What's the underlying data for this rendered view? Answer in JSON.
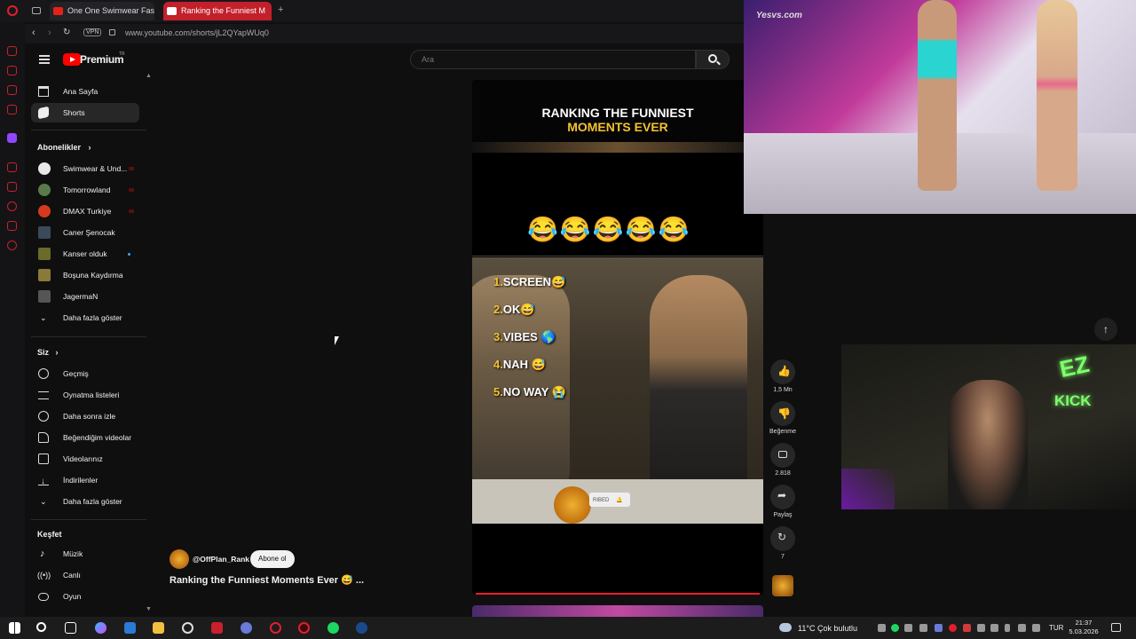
{
  "browser": {
    "tabs": [
      {
        "label": "One One Swimwear Fashi",
        "active": false
      },
      {
        "label": "Ranking the Funniest M",
        "active": true
      }
    ],
    "new_tab": "+",
    "vpn_badge": "VPN",
    "url": "www.youtube.com/shorts/jL2QYapWUq0"
  },
  "header": {
    "logo_text": "Premium",
    "logo_badge": "TR",
    "search_placeholder": "Ara"
  },
  "sidebar": {
    "main": [
      {
        "label": "Ana Sayfa",
        "icon": "home-icon"
      },
      {
        "label": "Shorts",
        "icon": "shorts-icon",
        "active": true
      }
    ],
    "subscriptions_title": "Abonelikler",
    "subscriptions": [
      {
        "label": "Swimwear & Und..."
      },
      {
        "label": "Tomorrowland"
      },
      {
        "label": "DMAX Turkiye"
      },
      {
        "label": "Caner Şenocak"
      },
      {
        "label": "Kanser olduk"
      },
      {
        "label": "Boşuna Kaydırma"
      },
      {
        "label": "JagermaN"
      }
    ],
    "show_more_1": "Daha fazla göster",
    "you_title": "Siz",
    "you_items": [
      {
        "label": "Geçmiş",
        "icon": "history-icon"
      },
      {
        "label": "Oynatma listeleri",
        "icon": "playlist-icon"
      },
      {
        "label": "Daha sonra izle",
        "icon": "watch-later-icon"
      },
      {
        "label": "Beğendiğim videolar",
        "icon": "like-icon"
      },
      {
        "label": "Videolarınız",
        "icon": "your-videos-icon"
      },
      {
        "label": "İndirilenler",
        "icon": "download-icon"
      }
    ],
    "show_more_2": "Daha fazla göster",
    "explore_title": "Keşfet",
    "explore_items": [
      {
        "label": "Müzik",
        "icon": "music-icon"
      },
      {
        "label": "Canlı",
        "icon": "live-icon"
      },
      {
        "label": "Oyun",
        "icon": "gaming-icon"
      }
    ]
  },
  "short": {
    "banner_line1": "RANKING THE FUNNIEST",
    "banner_line2": "MOMENTS EVER",
    "emoji_row": "😂😂😂😂😂",
    "list": [
      {
        "n": "1.",
        "text": "SCREEN😅"
      },
      {
        "n": "2.",
        "text": "OK😅"
      },
      {
        "n": "3.",
        "text": "VIBES 🌎"
      },
      {
        "n": "4.",
        "text": "NAH 😅"
      },
      {
        "n": "5.",
        "text": "NO WAY 😭"
      }
    ],
    "subscribed_badge": "RIBED",
    "channel": "@OffPlan_Rank",
    "subscribe_label": "Abone ol",
    "title": "Ranking the Funniest Moments Ever 😅 ..."
  },
  "actions": {
    "like_count": "1,5 Mn",
    "dislike_label": "Beğenme",
    "comment_count": "2.818",
    "share_label": "Paylaş",
    "remix_count": "7"
  },
  "overlay_cam": {
    "neon_line1": "EZ",
    "neon_line2": "KICK"
  },
  "overlay_top": {
    "watermark": "Yesvs.com"
  },
  "taskbar": {
    "weather": "11°C  Çok bulutlu",
    "lang": "TUR",
    "time": "21:37",
    "date": "5.03.2026"
  },
  "colors": {
    "youtube_red": "#ff0000",
    "background": "#0f0f0f",
    "accent_yellow": "#f2c230",
    "neon_green": "#7dff6a"
  }
}
